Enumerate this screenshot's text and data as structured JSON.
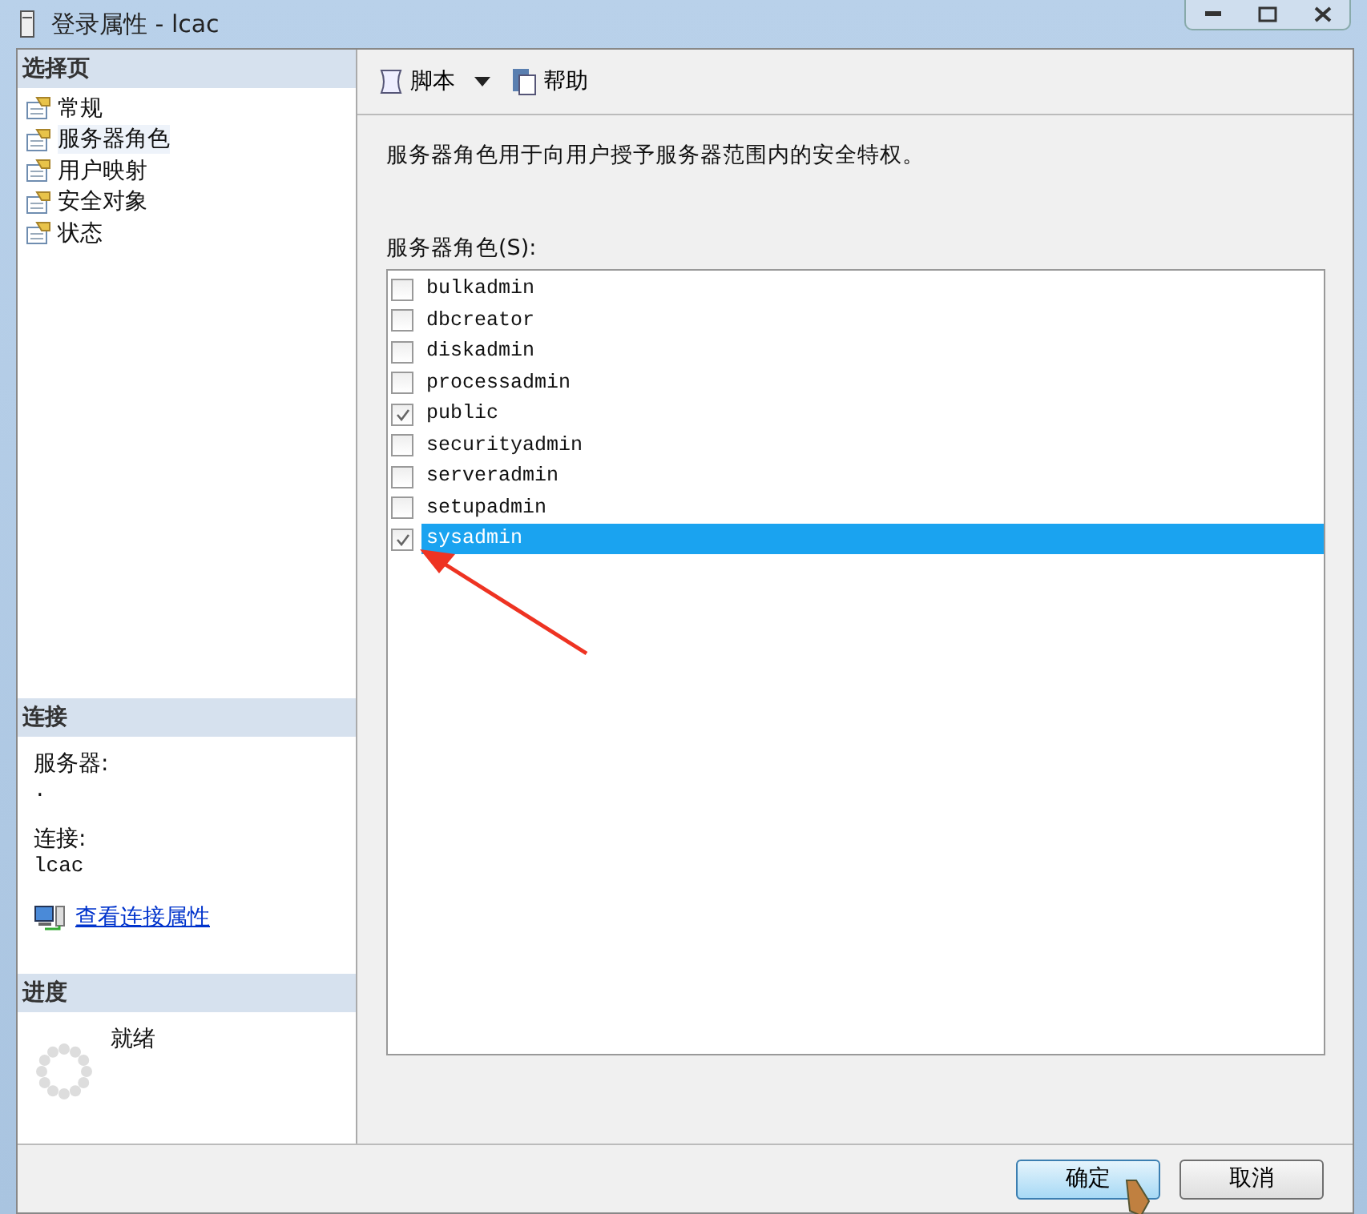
{
  "window": {
    "title": "登录属性 - lcac"
  },
  "sidebar": {
    "header": "选择页",
    "items": [
      {
        "label": "常规",
        "selected": false
      },
      {
        "label": "服务器角色",
        "selected": true
      },
      {
        "label": "用户映射",
        "selected": false
      },
      {
        "label": "安全对象",
        "selected": false
      },
      {
        "label": "状态",
        "selected": false
      }
    ]
  },
  "connection": {
    "header": "连接",
    "server_label": "服务器:",
    "server_value": ".",
    "connection_label": "连接:",
    "connection_value": "lcac",
    "link": "查看连接属性"
  },
  "progress": {
    "header": "进度",
    "status": "就绪"
  },
  "toolbar": {
    "script": "脚本",
    "help": "帮助"
  },
  "description": "服务器角色用于向用户授予服务器范围内的安全特权。",
  "roles_label": "服务器角色(S):",
  "roles": [
    {
      "name": "bulkadmin",
      "checked": false,
      "selected": false
    },
    {
      "name": "dbcreator",
      "checked": false,
      "selected": false
    },
    {
      "name": "diskadmin",
      "checked": false,
      "selected": false
    },
    {
      "name": "processadmin",
      "checked": false,
      "selected": false
    },
    {
      "name": "public",
      "checked": true,
      "selected": false
    },
    {
      "name": "securityadmin",
      "checked": false,
      "selected": false
    },
    {
      "name": "serveradmin",
      "checked": false,
      "selected": false
    },
    {
      "name": "setupadmin",
      "checked": false,
      "selected": false
    },
    {
      "name": "sysadmin",
      "checked": true,
      "selected": true
    }
  ],
  "buttons": [
    {
      "label": "确定",
      "kind": "default"
    },
    {
      "label": "取消",
      "kind": "normal"
    }
  ]
}
